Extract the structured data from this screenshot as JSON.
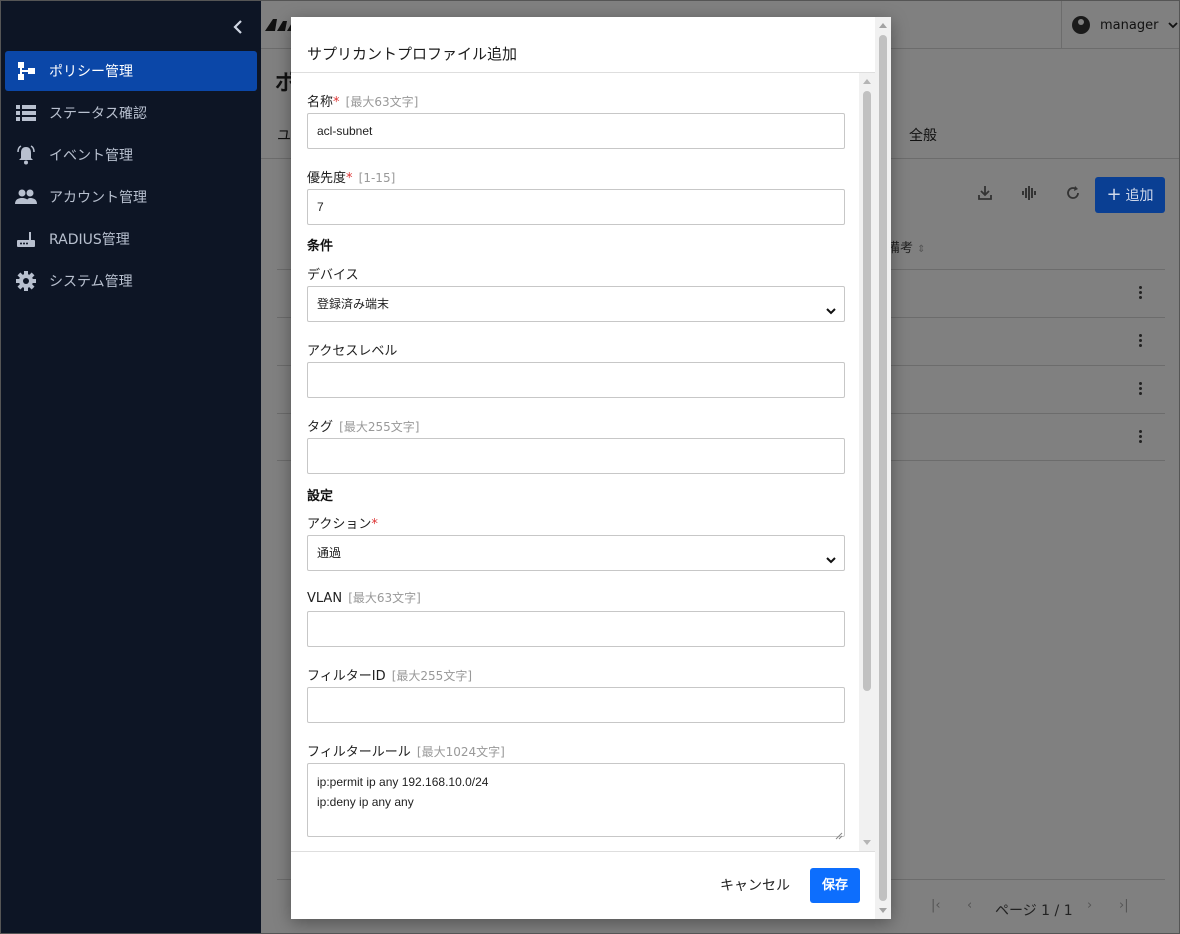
{
  "sidebar": {
    "items": [
      {
        "label": "ポリシー管理",
        "icon": "policy-tree-icon",
        "active": true
      },
      {
        "label": "ステータス確認",
        "icon": "list-icon",
        "active": false
      },
      {
        "label": "イベント管理",
        "icon": "bell-icon",
        "active": false
      },
      {
        "label": "アカウント管理",
        "icon": "people-icon",
        "active": false
      },
      {
        "label": "RADIUS管理",
        "icon": "router-icon",
        "active": false
      },
      {
        "label": "システム管理",
        "icon": "gear-icon",
        "active": false
      }
    ],
    "colors": {
      "background": "#0d1525",
      "active": "#0b47a8"
    }
  },
  "header": {
    "user_name": "manager",
    "page_title_partial": "ポ",
    "tab_partial": "ユ",
    "tab_all": "全般",
    "add_button": "追加",
    "column_remark_partial": "備考"
  },
  "pager": {
    "text": "ページ 1 / 1"
  },
  "modal": {
    "title": "サプリカントプロファイル追加",
    "fields": {
      "name": {
        "label": "名称",
        "required": "*",
        "hint": "[最大63文字]",
        "value": "acl-subnet"
      },
      "priority": {
        "label": "優先度",
        "required": "*",
        "hint": "[1-15]",
        "value": "7"
      },
      "condition_section": "条件",
      "device": {
        "label": "デバイス",
        "value": "登録済み端末"
      },
      "access_level": {
        "label": "アクセスレベル",
        "value": ""
      },
      "tag": {
        "label": "タグ",
        "hint": "[最大255文字]",
        "value": ""
      },
      "settings_section": "設定",
      "action": {
        "label": "アクション",
        "required": "*",
        "value": "通過"
      },
      "vlan": {
        "label": "VLAN",
        "hint": "[最大63文字]",
        "value": ""
      },
      "filter_id": {
        "label": "フィルターID",
        "hint": "[最大255文字]",
        "value": ""
      },
      "filter_rule": {
        "label": "フィルタールール",
        "hint": "[最大1024文字]",
        "line1": "ip:permit ip any 192.168.10.0/24",
        "line2": "ip:deny ip any any"
      }
    },
    "cancel": "キャンセル",
    "save": "保存"
  }
}
